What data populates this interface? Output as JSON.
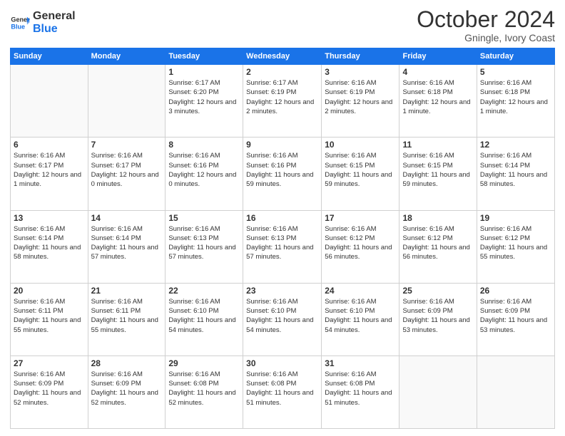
{
  "logo": {
    "line1": "General",
    "line2": "Blue"
  },
  "title": "October 2024",
  "subtitle": "Gningle, Ivory Coast",
  "days_of_week": [
    "Sunday",
    "Monday",
    "Tuesday",
    "Wednesday",
    "Thursday",
    "Friday",
    "Saturday"
  ],
  "weeks": [
    [
      {
        "day": "",
        "info": ""
      },
      {
        "day": "",
        "info": ""
      },
      {
        "day": "1",
        "info": "Sunrise: 6:17 AM\nSunset: 6:20 PM\nDaylight: 12 hours and 3 minutes."
      },
      {
        "day": "2",
        "info": "Sunrise: 6:17 AM\nSunset: 6:19 PM\nDaylight: 12 hours and 2 minutes."
      },
      {
        "day": "3",
        "info": "Sunrise: 6:16 AM\nSunset: 6:19 PM\nDaylight: 12 hours and 2 minutes."
      },
      {
        "day": "4",
        "info": "Sunrise: 6:16 AM\nSunset: 6:18 PM\nDaylight: 12 hours and 1 minute."
      },
      {
        "day": "5",
        "info": "Sunrise: 6:16 AM\nSunset: 6:18 PM\nDaylight: 12 hours and 1 minute."
      }
    ],
    [
      {
        "day": "6",
        "info": "Sunrise: 6:16 AM\nSunset: 6:17 PM\nDaylight: 12 hours and 1 minute."
      },
      {
        "day": "7",
        "info": "Sunrise: 6:16 AM\nSunset: 6:17 PM\nDaylight: 12 hours and 0 minutes."
      },
      {
        "day": "8",
        "info": "Sunrise: 6:16 AM\nSunset: 6:16 PM\nDaylight: 12 hours and 0 minutes."
      },
      {
        "day": "9",
        "info": "Sunrise: 6:16 AM\nSunset: 6:16 PM\nDaylight: 11 hours and 59 minutes."
      },
      {
        "day": "10",
        "info": "Sunrise: 6:16 AM\nSunset: 6:15 PM\nDaylight: 11 hours and 59 minutes."
      },
      {
        "day": "11",
        "info": "Sunrise: 6:16 AM\nSunset: 6:15 PM\nDaylight: 11 hours and 59 minutes."
      },
      {
        "day": "12",
        "info": "Sunrise: 6:16 AM\nSunset: 6:14 PM\nDaylight: 11 hours and 58 minutes."
      }
    ],
    [
      {
        "day": "13",
        "info": "Sunrise: 6:16 AM\nSunset: 6:14 PM\nDaylight: 11 hours and 58 minutes."
      },
      {
        "day": "14",
        "info": "Sunrise: 6:16 AM\nSunset: 6:14 PM\nDaylight: 11 hours and 57 minutes."
      },
      {
        "day": "15",
        "info": "Sunrise: 6:16 AM\nSunset: 6:13 PM\nDaylight: 11 hours and 57 minutes."
      },
      {
        "day": "16",
        "info": "Sunrise: 6:16 AM\nSunset: 6:13 PM\nDaylight: 11 hours and 57 minutes."
      },
      {
        "day": "17",
        "info": "Sunrise: 6:16 AM\nSunset: 6:12 PM\nDaylight: 11 hours and 56 minutes."
      },
      {
        "day": "18",
        "info": "Sunrise: 6:16 AM\nSunset: 6:12 PM\nDaylight: 11 hours and 56 minutes."
      },
      {
        "day": "19",
        "info": "Sunrise: 6:16 AM\nSunset: 6:12 PM\nDaylight: 11 hours and 55 minutes."
      }
    ],
    [
      {
        "day": "20",
        "info": "Sunrise: 6:16 AM\nSunset: 6:11 PM\nDaylight: 11 hours and 55 minutes."
      },
      {
        "day": "21",
        "info": "Sunrise: 6:16 AM\nSunset: 6:11 PM\nDaylight: 11 hours and 55 minutes."
      },
      {
        "day": "22",
        "info": "Sunrise: 6:16 AM\nSunset: 6:10 PM\nDaylight: 11 hours and 54 minutes."
      },
      {
        "day": "23",
        "info": "Sunrise: 6:16 AM\nSunset: 6:10 PM\nDaylight: 11 hours and 54 minutes."
      },
      {
        "day": "24",
        "info": "Sunrise: 6:16 AM\nSunset: 6:10 PM\nDaylight: 11 hours and 54 minutes."
      },
      {
        "day": "25",
        "info": "Sunrise: 6:16 AM\nSunset: 6:09 PM\nDaylight: 11 hours and 53 minutes."
      },
      {
        "day": "26",
        "info": "Sunrise: 6:16 AM\nSunset: 6:09 PM\nDaylight: 11 hours and 53 minutes."
      }
    ],
    [
      {
        "day": "27",
        "info": "Sunrise: 6:16 AM\nSunset: 6:09 PM\nDaylight: 11 hours and 52 minutes."
      },
      {
        "day": "28",
        "info": "Sunrise: 6:16 AM\nSunset: 6:09 PM\nDaylight: 11 hours and 52 minutes."
      },
      {
        "day": "29",
        "info": "Sunrise: 6:16 AM\nSunset: 6:08 PM\nDaylight: 11 hours and 52 minutes."
      },
      {
        "day": "30",
        "info": "Sunrise: 6:16 AM\nSunset: 6:08 PM\nDaylight: 11 hours and 51 minutes."
      },
      {
        "day": "31",
        "info": "Sunrise: 6:16 AM\nSunset: 6:08 PM\nDaylight: 11 hours and 51 minutes."
      },
      {
        "day": "",
        "info": ""
      },
      {
        "day": "",
        "info": ""
      }
    ]
  ]
}
